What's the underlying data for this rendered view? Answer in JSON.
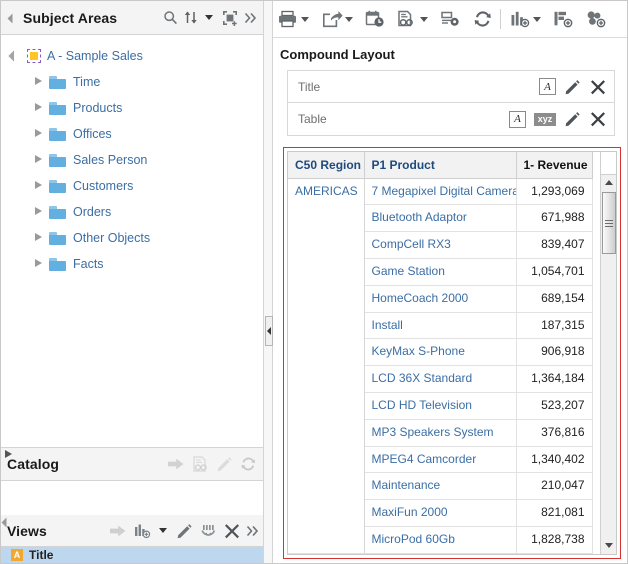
{
  "sidebar": {
    "subject_areas": {
      "title": "Subject Areas",
      "icons": [
        "search-icon",
        "sort-icon",
        "add-subject-area-icon",
        "more-icon"
      ],
      "root": {
        "label": "A - Sample Sales",
        "icon": "subject-area-icon"
      },
      "folders": [
        {
          "label": "Time"
        },
        {
          "label": "Products"
        },
        {
          "label": "Offices"
        },
        {
          "label": "Sales Person"
        },
        {
          "label": "Customers"
        },
        {
          "label": "Orders"
        },
        {
          "label": "Other Objects"
        },
        {
          "label": "Facts"
        }
      ]
    },
    "catalog": {
      "title": "Catalog",
      "icons": [
        "add-to-report-icon",
        "preview-icon",
        "edit-icon",
        "refresh-icon"
      ]
    },
    "views": {
      "title": "Views",
      "icons": [
        "add-view-icon",
        "new-view-icon",
        "edit-icon",
        "duplicate-icon",
        "remove-icon",
        "more-icon"
      ],
      "items": [
        {
          "label": "Title",
          "icon": "title-view-icon"
        }
      ]
    }
  },
  "toolbar": {
    "buttons": [
      {
        "name": "print-icon",
        "has_caret": true
      },
      {
        "name": "export-icon",
        "has_caret": true
      },
      {
        "name": "schedule-icon",
        "has_caret": false
      },
      {
        "name": "preview-report-icon",
        "has_caret": true
      },
      {
        "name": "edit-report-icon",
        "has_caret": false
      },
      {
        "name": "refresh-icon",
        "has_caret": false
      },
      {
        "name": "new-view-icon",
        "has_caret": true
      },
      {
        "name": "add-view-to-layout-icon",
        "has_caret": false
      },
      {
        "name": "new-compound-layout-icon",
        "has_caret": false
      }
    ]
  },
  "main": {
    "compound_layout_title": "Compound Layout",
    "layout_boxes": [
      {
        "label": "Title",
        "actions": [
          "format-container-icon",
          "edit-icon",
          "remove-icon"
        ]
      },
      {
        "label": "Table",
        "actions": [
          "format-container-icon",
          "xyz-properties-icon",
          "edit-icon",
          "remove-icon"
        ]
      }
    ],
    "table": {
      "columns": [
        "C50 Region",
        "P1 Product",
        "1- Revenue"
      ],
      "measure_prefix": "1-",
      "measure_name": " Revenue",
      "region": "AMERICAS",
      "rows": [
        {
          "product": "7 Megapixel Digital Camera",
          "revenue": "1,293,069"
        },
        {
          "product": "Bluetooth Adaptor",
          "revenue": "671,988"
        },
        {
          "product": "CompCell RX3",
          "revenue": "839,407"
        },
        {
          "product": "Game Station",
          "revenue": "1,054,701"
        },
        {
          "product": "HomeCoach 2000",
          "revenue": "689,154"
        },
        {
          "product": "Install",
          "revenue": "187,315"
        },
        {
          "product": "KeyMax S-Phone",
          "revenue": "906,918"
        },
        {
          "product": "LCD 36X Standard",
          "revenue": "1,364,184"
        },
        {
          "product": "LCD HD Television",
          "revenue": "523,207"
        },
        {
          "product": "MP3 Speakers System",
          "revenue": "376,816"
        },
        {
          "product": "MPEG4 Camcorder",
          "revenue": "1,340,402"
        },
        {
          "product": "Maintenance",
          "revenue": "210,047"
        },
        {
          "product": "MaxiFun 2000",
          "revenue": "821,081"
        },
        {
          "product": "MicroPod 60Gb",
          "revenue": "1,828,738"
        }
      ]
    }
  },
  "colors": {
    "link": "#3b6ea5",
    "header_text": "#1e4a7d",
    "selection_highlight": "#d53131",
    "panel_bg": "#f4f4f4",
    "selected_row": "#bcd7ee"
  }
}
